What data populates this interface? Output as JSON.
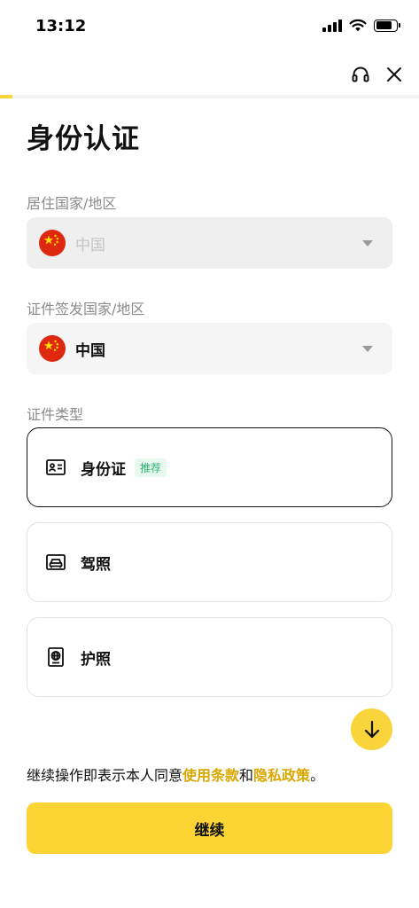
{
  "status_bar": {
    "time": "13:12"
  },
  "progress": {
    "fraction": 0.03
  },
  "page": {
    "title": "身份认证"
  },
  "residence": {
    "label": "居住国家/地区",
    "value": "中国"
  },
  "issuing": {
    "label": "证件签发国家/地区",
    "value": "中国"
  },
  "document": {
    "label": "证件类型",
    "options": [
      {
        "label": "身份证",
        "badge": "推荐",
        "selected": true
      },
      {
        "label": "驾照",
        "selected": false
      },
      {
        "label": "护照",
        "selected": false
      }
    ]
  },
  "agreement": {
    "prefix": "继续操作即表示本人同意",
    "terms_link": "使用条款",
    "conjunction": "和",
    "privacy_link": "隐私政策",
    "suffix": "。"
  },
  "footer": {
    "continue_label": "继续"
  },
  "colors": {
    "accent": "#fcd535",
    "link": "#d9a700",
    "badge_green": "#2bb673",
    "flag_red": "#de2910",
    "flag_yellow": "#ffde00"
  }
}
